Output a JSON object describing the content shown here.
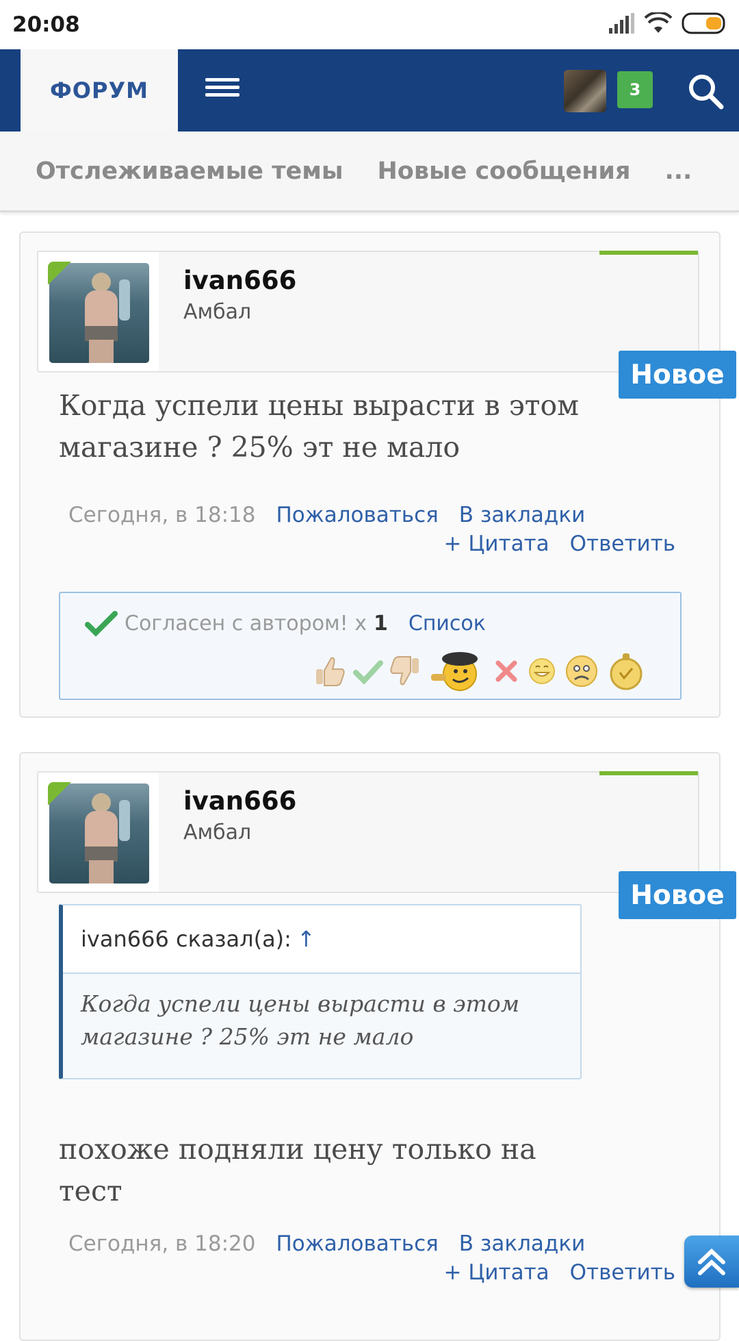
{
  "status_bar": {
    "time": "20:08"
  },
  "header": {
    "forum_tab": "ФОРУМ",
    "notification_count": "3"
  },
  "subnav": {
    "items": [
      "Отслеживаемые темы",
      "Новые сообщения"
    ],
    "more": "..."
  },
  "posts": [
    {
      "username": "ivan666",
      "user_title": "Амбал",
      "new_label": "Новое",
      "message": "Когда успели цены вырасти в этом магазине ? 25% эт не мало",
      "date": "Сегодня, в 18:18",
      "report": "Пожаловаться",
      "bookmark": "В закладки",
      "quote_action": "+ Цитата",
      "reply": "Ответить",
      "likes": {
        "text": "Согласен с автором! x",
        "count": "1",
        "list_link": "Список"
      }
    },
    {
      "username": "ivan666",
      "user_title": "Амбал",
      "new_label": "Новое",
      "quote": {
        "author": "ivan666 сказал(а):",
        "arrow": "↑",
        "text": "Когда успели цены вырасти в этом магазине ? 25% эт не мало"
      },
      "message": "похоже подняли цену только на тест",
      "date": "Сегодня, в 18:20",
      "report": "Пожаловаться",
      "bookmark": "В закладки",
      "quote_action": "+ Цитата",
      "reply": "Ответить"
    }
  ],
  "colors": {
    "header_bg": "#17407f",
    "accent_blue": "#2e8bd6",
    "link": "#2f60a8",
    "online_green": "#7ab832",
    "badge_green": "#4caf50"
  }
}
